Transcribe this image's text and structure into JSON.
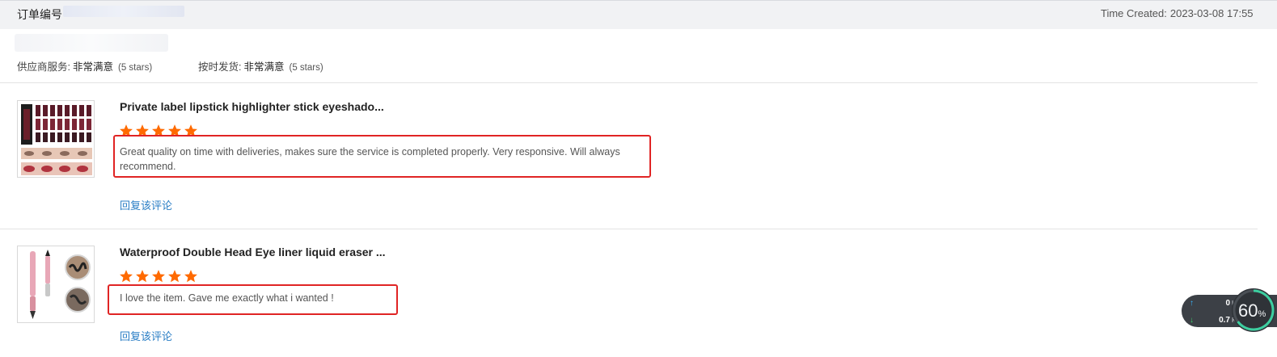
{
  "header": {
    "order_label": "订单编号",
    "time_created_label": "Time Created:",
    "time_created_value": "2023-03-08 17:55"
  },
  "seller_ratings": [
    {
      "label": "供应商服务:",
      "value": "非常满意",
      "stars_text": "(5 stars)"
    },
    {
      "label": "按时发货:",
      "value": "非常满意",
      "stars_text": "(5 stars)"
    }
  ],
  "reviews": [
    {
      "product_title": "Private label lipstick highlighter stick eyeshado...",
      "rating": 5,
      "text": "Great quality on time with deliveries, makes sure the service is completed properly. Very responsive. Will always recommend.",
      "reply_label": "回复该评论"
    },
    {
      "product_title": "Waterproof Double Head Eye liner liquid eraser ...",
      "rating": 5,
      "text": "I love the item. Gave me exactly what i wanted !",
      "reply_label": "回复该评论"
    }
  ],
  "net_widget": {
    "upload_value": "0",
    "upload_unit": "K/s",
    "download_value": "0.7",
    "download_unit": "K/s",
    "percent": "60",
    "percent_sign": "%"
  },
  "colors": {
    "star": "#ff6a00",
    "highlight": "#e02424",
    "link": "#2a7ec5"
  }
}
